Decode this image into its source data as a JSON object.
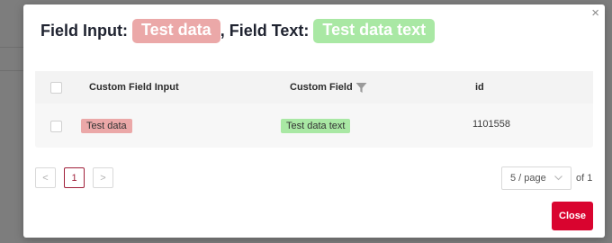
{
  "modal": {
    "title_prefix_1": "Field Input:",
    "title_value_1": "Test data",
    "title_sep": ", ",
    "title_prefix_2": "Field Text:",
    "title_value_2": "Test data text",
    "close_glyph": "×"
  },
  "table": {
    "headers": [
      "Custom Field Input",
      "Custom Field",
      "id"
    ],
    "rows": [
      {
        "custom_field_input": "Test data",
        "custom_field": "Test data text",
        "id": "1101558"
      }
    ]
  },
  "pagination": {
    "prev": "<",
    "current_page": "1",
    "next": ">",
    "page_size": "5 / page",
    "of_text": "of 1"
  },
  "footer": {
    "close_label": "Close"
  },
  "colors": {
    "accent": "#d9042f",
    "pill_red": "#eba8a8",
    "pill_green": "#a9e8a4",
    "active_page": "#a0203a"
  },
  "icons": [
    "close-icon",
    "filter-icon",
    "chevron-left-icon",
    "chevron-right-icon",
    "chevron-down-icon"
  ]
}
